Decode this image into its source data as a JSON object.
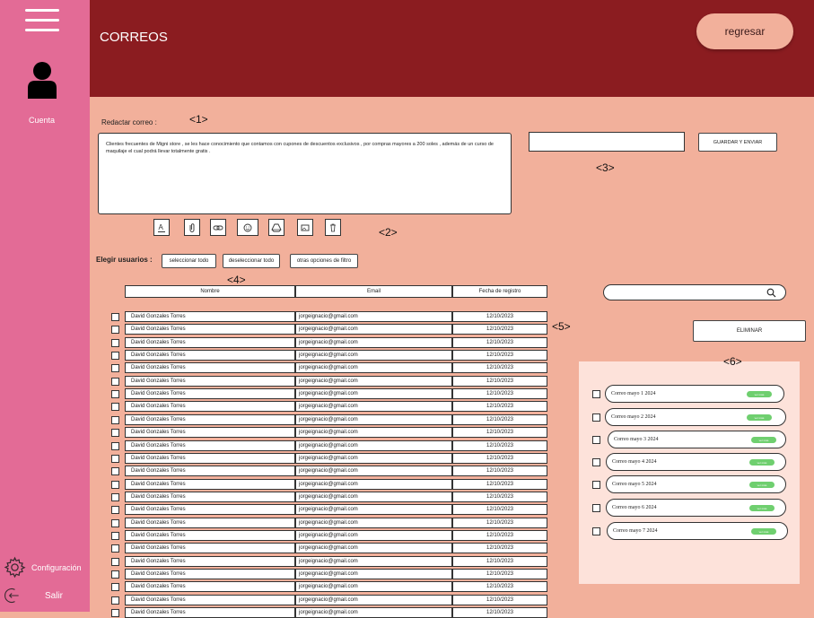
{
  "sidebar": {
    "account_label": "Cuenta",
    "config_label": "Configuración",
    "logout_label": "Salir"
  },
  "header": {
    "title": "CORREOS",
    "back_label": "regresar"
  },
  "compose": {
    "label": "Redactar correo :",
    "body": "Clientes frecuentes de Migni store , se les hace conocimiento que contamos con cupones de descuentos exclusivos , por compras mayores a 200 soles , además de un curso de maquilaje el cual podrá llevar totalmente gratis .",
    "subject_value": "",
    "save_send_label": "GUARDAR Y ENVIAR"
  },
  "markers": {
    "m1": "<1>",
    "m2": "<2>",
    "m3": "<3>",
    "m4": "<4>",
    "m5": "<5>",
    "m6": "<6>"
  },
  "toolbar": {
    "icons": [
      "text-format-icon",
      "attach-icon",
      "link-icon",
      "emoji-icon",
      "drive-icon",
      "image-icon",
      "trash-icon"
    ]
  },
  "users": {
    "label": "Elegir usuarios :",
    "select_all": "seleccionar todo",
    "deselect_all": "deseleccionar todo",
    "more_filters": "otras opciones de filtro",
    "columns": [
      "Nombre",
      "Email",
      "Fecha de registro"
    ],
    "rows": [
      [
        "David Gonzales Torres",
        "jorgeignacio@gmail.com",
        "12/10/2023"
      ],
      [
        "David Gonzales Torres",
        "jorgeignacio@gmail.com",
        "12/10/2023"
      ],
      [
        "David Gonzales Torres",
        "jorgeignacio@gmail.com",
        "12/10/2023"
      ],
      [
        "David Gonzales Torres",
        "jorgeignacio@gmail.com",
        "12/10/2023"
      ],
      [
        "David Gonzales Torres",
        "jorgeignacio@gmail.com",
        "12/10/2023"
      ],
      [
        "David Gonzales Torres",
        "jorgeignacio@gmail.com",
        "12/10/2023"
      ],
      [
        "David Gonzales Torres",
        "jorgeignacio@gmail.com",
        "12/10/2023"
      ],
      [
        "David Gonzales Torres",
        "jorgeignacio@gmail.com",
        "12/10/2023"
      ],
      [
        "David Gonzales Torres",
        "jorgeignacio@gmail.com",
        "12/10/2023"
      ],
      [
        "David Gonzales Torres",
        "jorgeignacio@gmail.com",
        "12/10/2023"
      ],
      [
        "David Gonzales Torres",
        "jorgeignacio@gmail.com",
        "12/10/2023"
      ],
      [
        "David Gonzales Torres",
        "jorgeignacio@gmail.com",
        "12/10/2023"
      ],
      [
        "David Gonzales Torres",
        "jorgeignacio@gmail.com",
        "12/10/2023"
      ],
      [
        "David Gonzales Torres",
        "jorgeignacio@gmail.com",
        "12/10/2023"
      ],
      [
        "David Gonzales Torres",
        "jorgeignacio@gmail.com",
        "12/10/2023"
      ],
      [
        "David Gonzales Torres",
        "jorgeignacio@gmail.com",
        "12/10/2023"
      ],
      [
        "David Gonzales Torres",
        "jorgeignacio@gmail.com",
        "12/10/2023"
      ],
      [
        "David Gonzales Torres",
        "jorgeignacio@gmail.com",
        "12/10/2023"
      ],
      [
        "David Gonzales Torres",
        "jorgeignacio@gmail.com",
        "12/10/2023"
      ],
      [
        "David Gonzales Torres",
        "jorgeignacio@gmail.com",
        "12/10/2023"
      ],
      [
        "David Gonzales Torres",
        "jorgeignacio@gmail.com",
        "12/10/2023"
      ],
      [
        "David Gonzales Torres",
        "jorgeignacio@gmail.com",
        "12/10/2023"
      ],
      [
        "David Gonzales Torres",
        "jorgeignacio@gmail.com",
        "12/10/2023"
      ],
      [
        "David Gonzales Torres",
        "jorgeignacio@gmail.com",
        "12/10/2023"
      ]
    ]
  },
  "drafts": {
    "search_value": "",
    "delete_label": "ELIMINAR",
    "items": [
      {
        "title": "Correo mayo 1 2024",
        "pill": "ver más"
      },
      {
        "title": "Correo mayo 2 2024",
        "pill": "ver más"
      },
      {
        "title": "Correo mayo 3 2024",
        "pill": "ver más"
      },
      {
        "title": "Correo mayo 4 2024",
        "pill": "ver más"
      },
      {
        "title": "Correo mayo 5 2024",
        "pill": "ver más"
      },
      {
        "title": "Correo  mayo 6 2024",
        "pill": "ver más"
      },
      {
        "title": "Correo mayo 7 2024",
        "pill": "ver más"
      }
    ]
  },
  "colors": {
    "sidebar": "#e36b96",
    "header": "#8b1c20",
    "background": "#f2b09b",
    "panel": "#fde2da",
    "pill": "#6fcf6f"
  }
}
